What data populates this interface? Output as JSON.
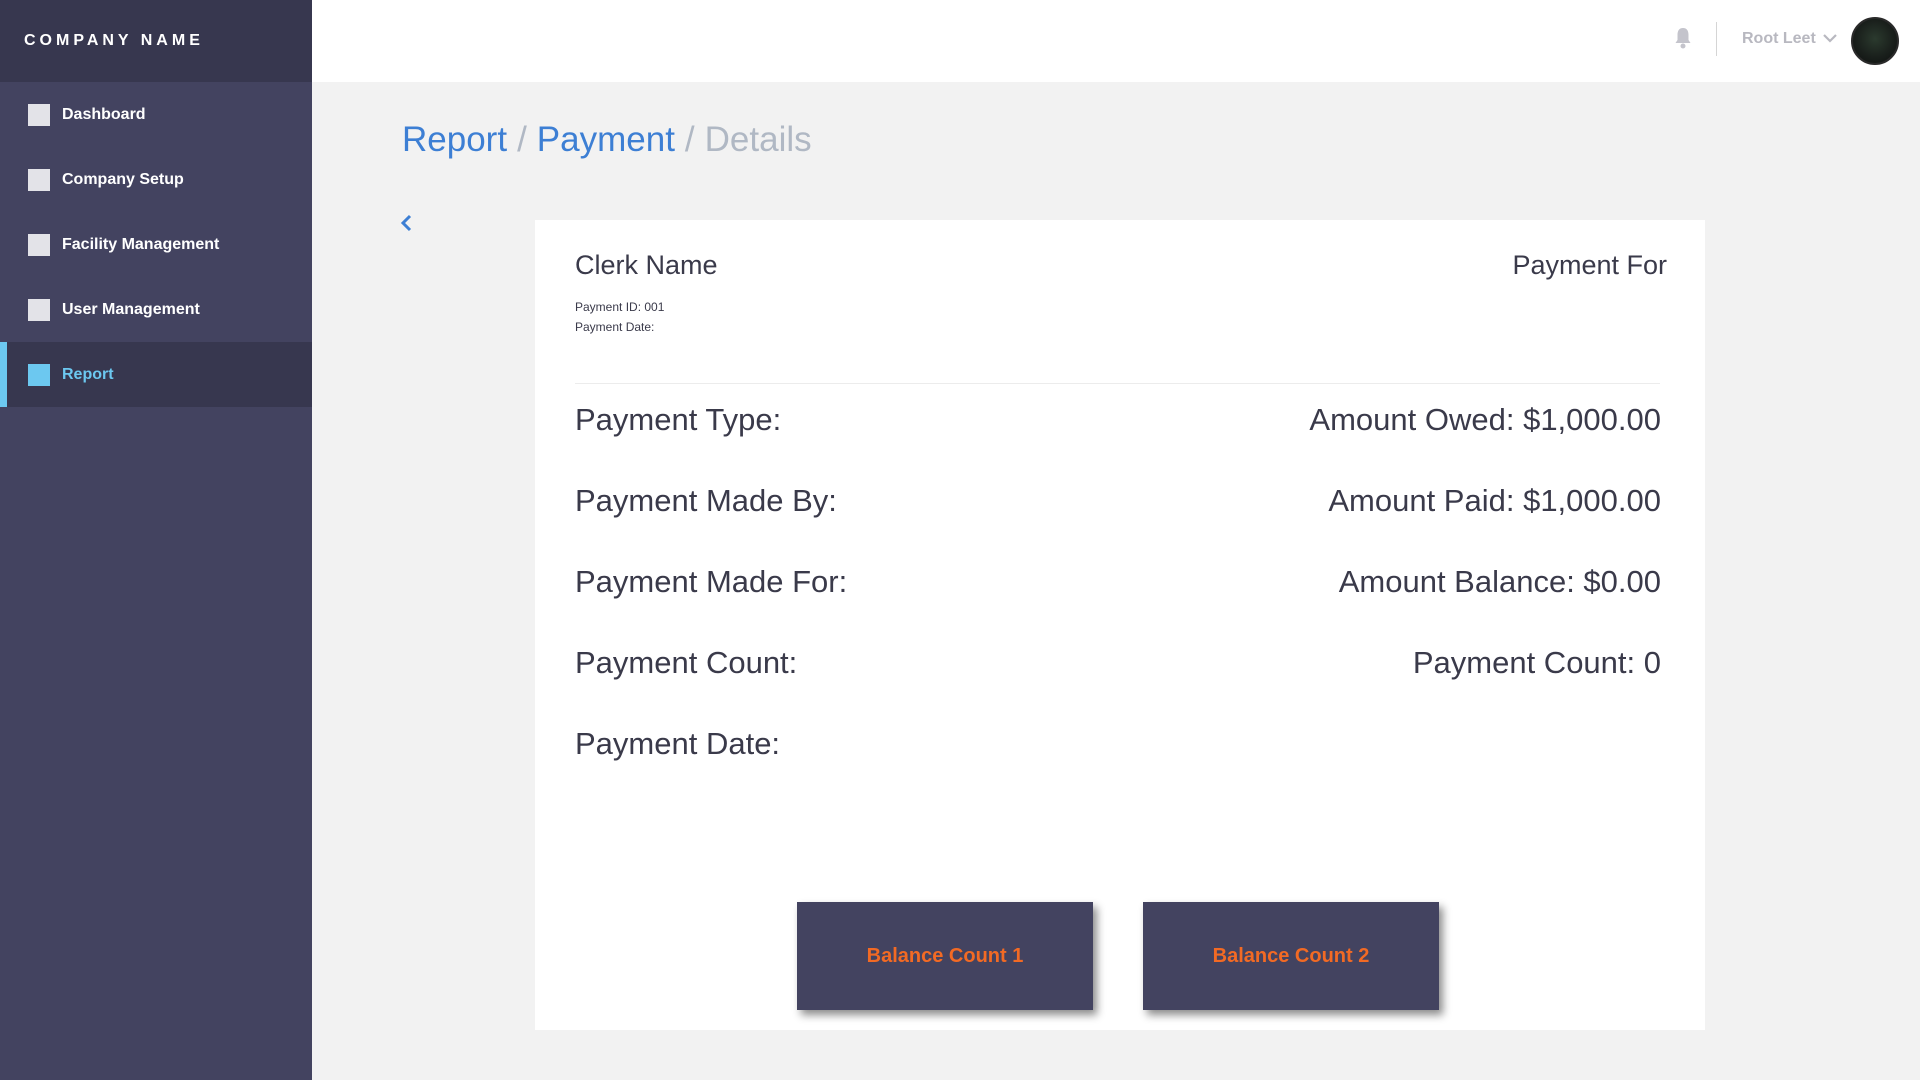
{
  "brand": {
    "name": "COMPANY NAME"
  },
  "sidebar": {
    "items": [
      {
        "label": "Dashboard"
      },
      {
        "label": "Company Setup"
      },
      {
        "label": "Facility Management"
      },
      {
        "label": "User Management"
      },
      {
        "label": "Report",
        "active": true
      }
    ]
  },
  "topbar": {
    "user_name": "Root Leet",
    "icons": [
      "bell-icon",
      "chevron-down-icon",
      "avatar"
    ]
  },
  "breadcrumb": {
    "items": [
      "Report",
      "Payment",
      "Details"
    ],
    "separator": "/"
  },
  "card": {
    "clerk_name": "Clerk Name",
    "payment_for": "Payment For",
    "payment_id": "Payment ID: 001",
    "payment_date_meta": "Payment Date:",
    "left_rows": [
      "Payment Type:",
      "Payment Made By:",
      "Payment Made For:",
      "Payment Count:",
      "Payment Date:"
    ],
    "right_rows": [
      "Amount Owed: $1,000.00",
      "Amount Paid: $1,000.00",
      "Amount Balance: $0.00",
      "Payment Count: 0"
    ],
    "buttons": [
      "Balance Count 1",
      "Balance Count 2"
    ]
  },
  "colors": {
    "sidebar_bg": "#434360",
    "accent": "#6cc8f0",
    "link": "#3d7fd4",
    "button_text": "#f26a24"
  }
}
